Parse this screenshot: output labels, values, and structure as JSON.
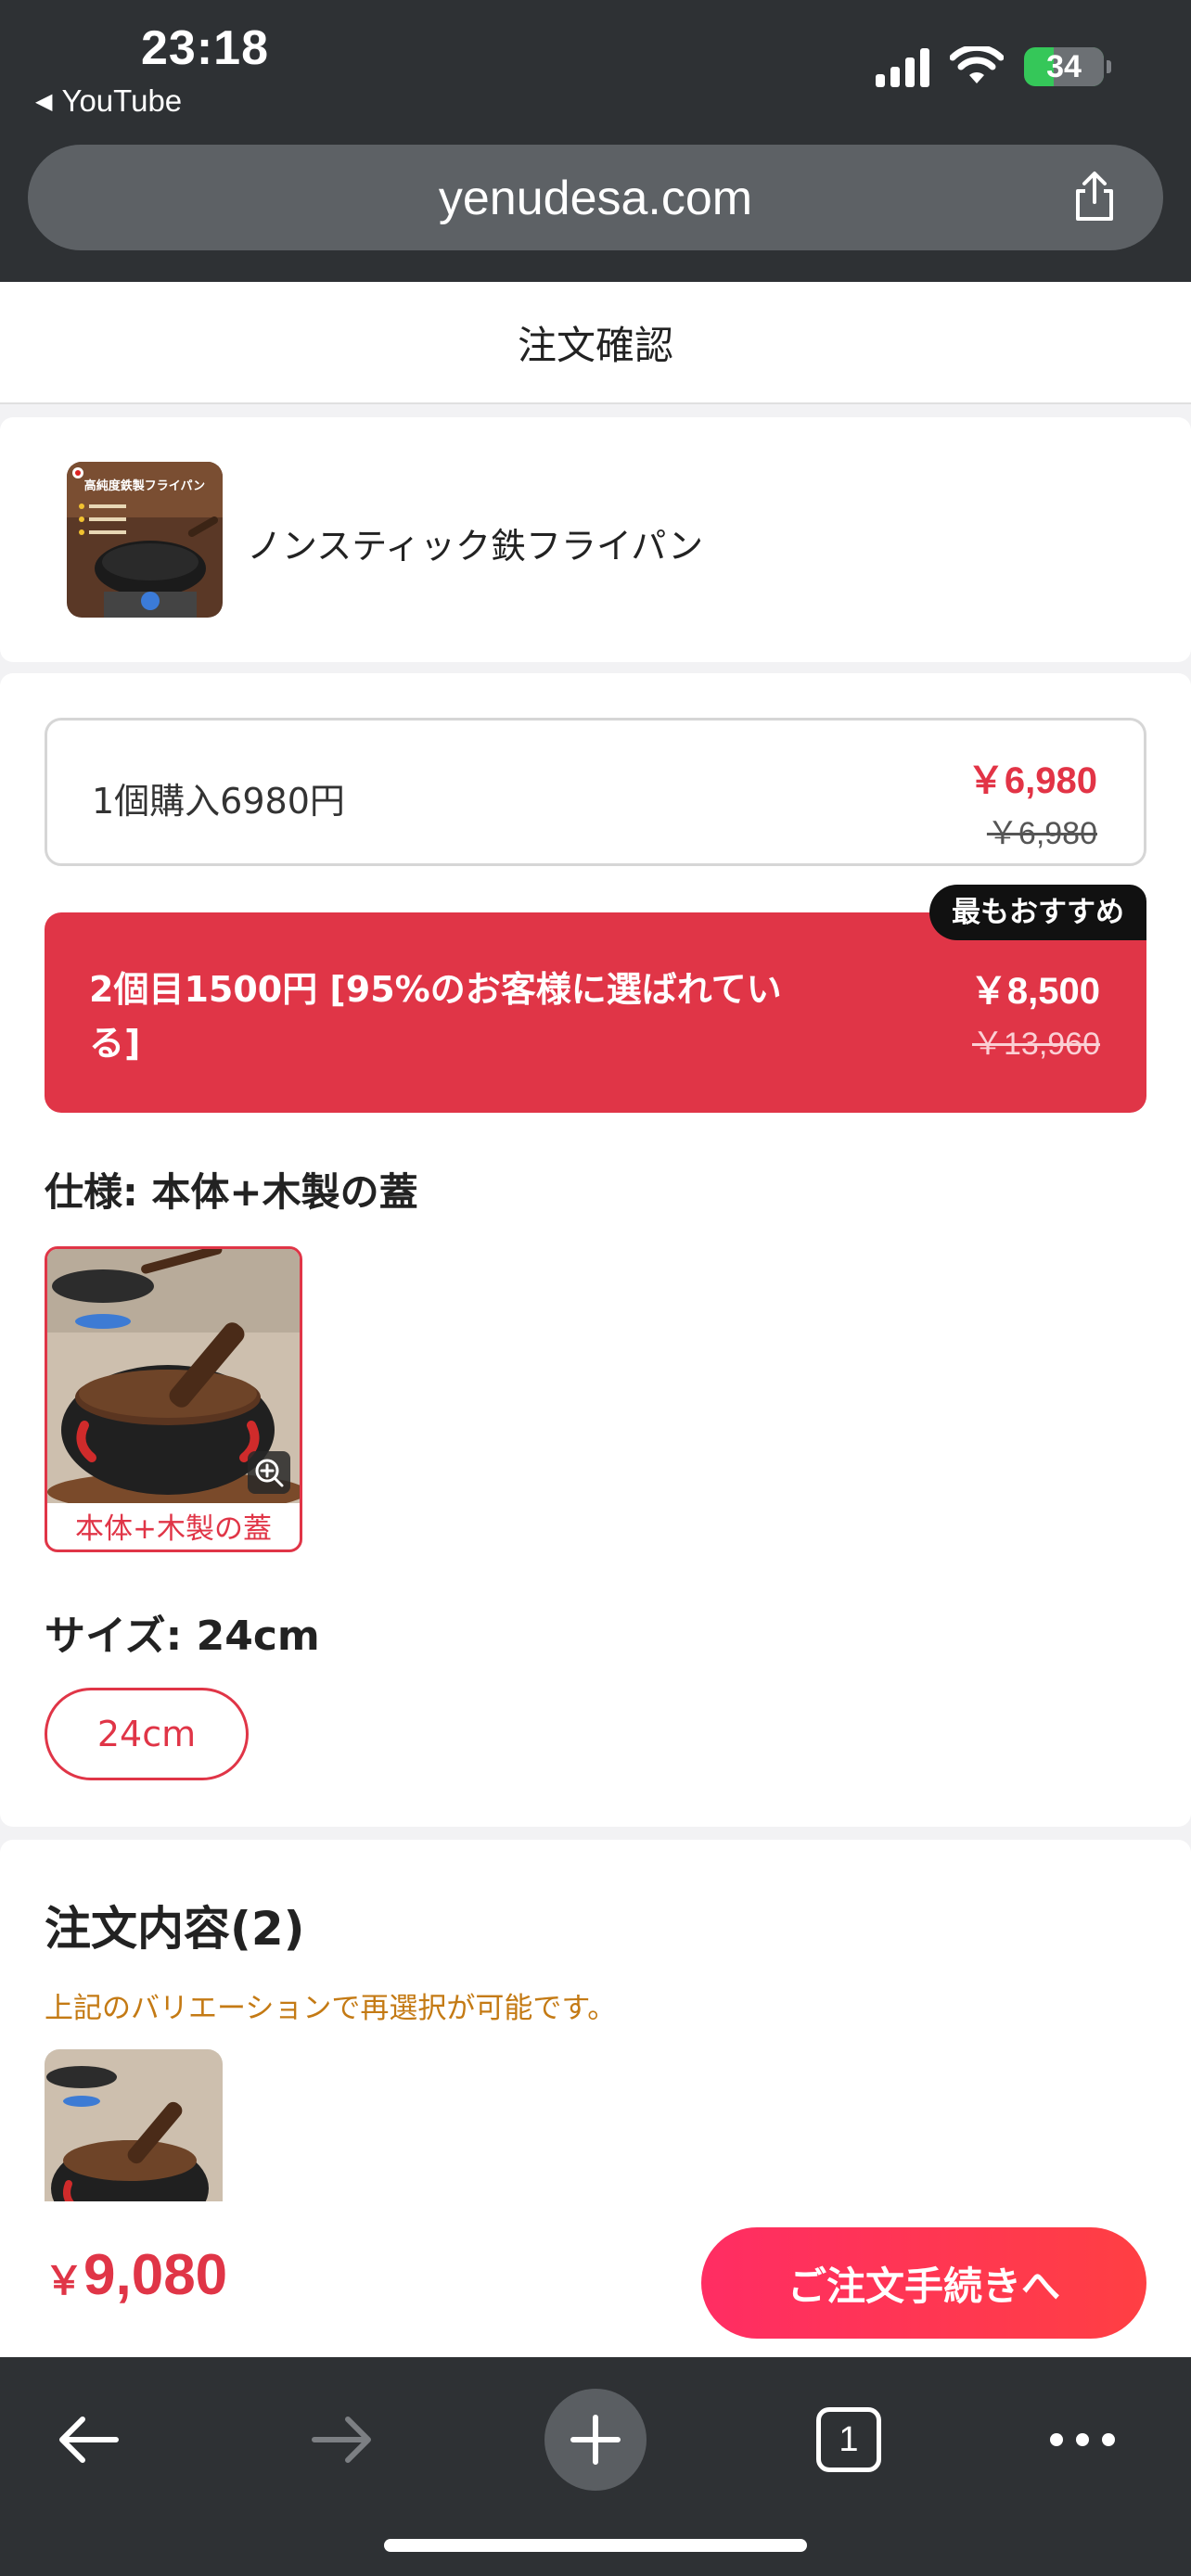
{
  "status_bar": {
    "time": "23:18",
    "back_app": "YouTube",
    "battery": "34"
  },
  "browser": {
    "url": "yenudesa.com",
    "tab_count": "1"
  },
  "page": {
    "title": "注文確認"
  },
  "product": {
    "name": "ノンスティック鉄フライパン",
    "thumb_text": "高純度鉄製フライパン"
  },
  "options": [
    {
      "label": "1個購入6980円",
      "price": "￥6,980",
      "original_price": "￥6,980"
    },
    {
      "label": "2個目1500円 [95%のお客様に選ばれている]",
      "price": "￥8,500",
      "original_price": "￥13,960",
      "badge": "最もおすすめ"
    }
  ],
  "spec": {
    "title": "仕様: 本体+木製の蓋",
    "tile_caption": "本体+木製の蓋"
  },
  "size": {
    "title": "サイズ: 24cm",
    "selected": "24cm"
  },
  "order": {
    "title": "注文内容(2)",
    "note": "上記のバリエーションで再選択が可能です。",
    "qty": "2"
  },
  "checkout": {
    "currency": "￥",
    "total": "9,080",
    "button": "ご注文手続きへ"
  },
  "colors": {
    "accent": "#e03547",
    "chrome": "#2e3134",
    "note": "#c47a14"
  }
}
